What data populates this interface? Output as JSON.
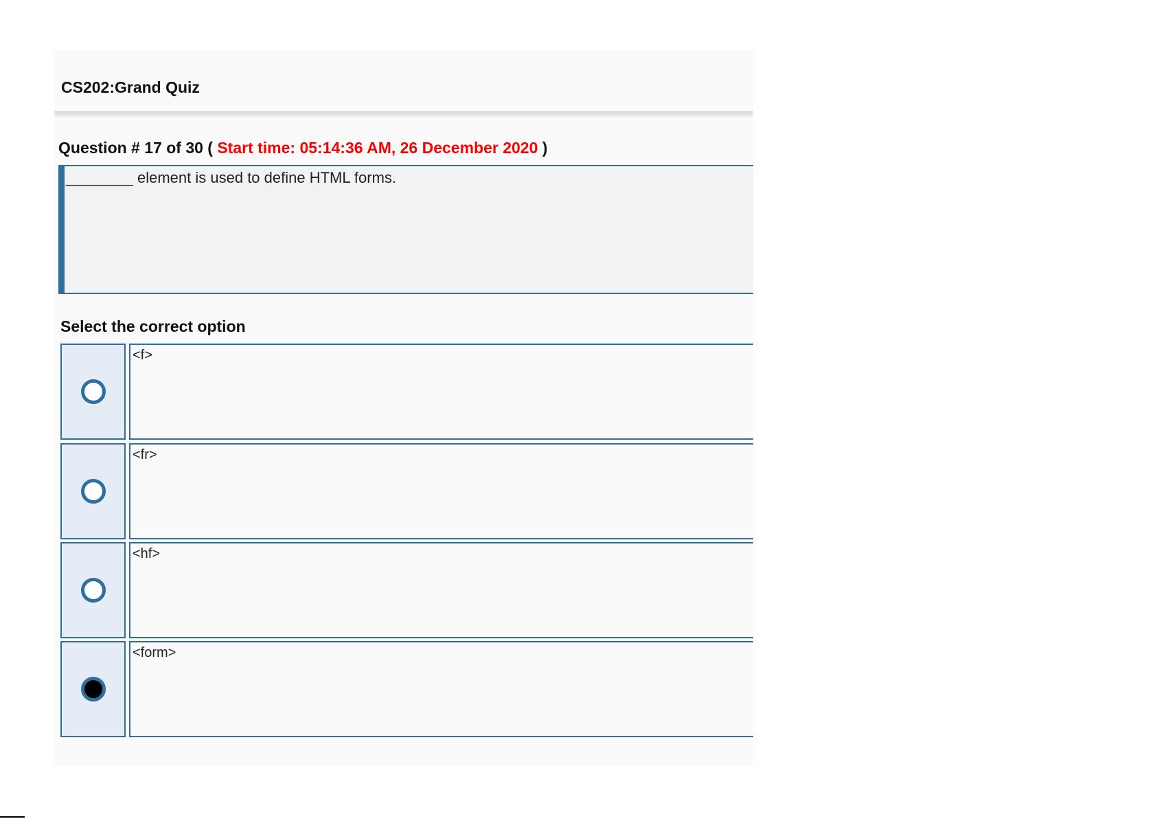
{
  "quiz": {
    "title": "CS202:Grand Quiz"
  },
  "question": {
    "prefix": "Question # 17 of 30 ( ",
    "start_time": "Start time: 05:14:36 AM, 26 December 2020",
    "suffix": " )",
    "text": "________ element is used to define HTML forms."
  },
  "options_label": "Select the correct option",
  "options": [
    {
      "label": "<f>",
      "selected": false
    },
    {
      "label": "<fr>",
      "selected": false
    },
    {
      "label": "<hf>",
      "selected": false
    },
    {
      "label": "<form>",
      "selected": true
    }
  ],
  "colors": {
    "accent": "#2e6f9e",
    "start_time": "#ff0000",
    "radio_cell_bg": "#e6ecf5",
    "question_bg": "#f2f2f2"
  }
}
